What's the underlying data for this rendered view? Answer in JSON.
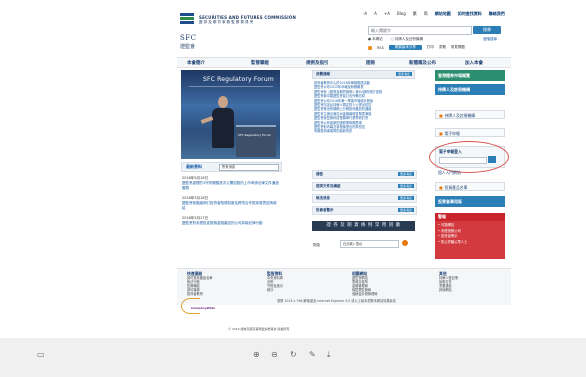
{
  "header": {
    "org_en": "SECURITIES AND FUTURES COMMISSION",
    "org_zh": "證 券 及 期 貨 事 務 監 察 委 員 會",
    "abbr": "SFC",
    "abbr_zh": "證監會",
    "topnav": [
      "-A",
      "A",
      "+A",
      "Blog",
      "繁",
      "简",
      "網站地圖",
      "如何查找資料",
      "聯絡我們"
    ],
    "search_placeholder": "輸入關鍵字",
    "search_button": "搜尋",
    "search_options": [
      "● 本網站",
      "○ 持牌人及註冊機構"
    ],
    "advanced": "進階搜尋",
    "tools": [
      "RSS",
      "網頁版本分享",
      "打印",
      "書籤",
      "常見問題"
    ]
  },
  "mainnav": [
    "本會簡介",
    "監管職能",
    "規例及指引",
    "諮詢",
    "新聞稿及公布",
    "加入本會"
  ],
  "banner": {
    "title": "SFC Regulatory Forum",
    "podium_label": "SFC Regulatory Forum"
  },
  "latest": {
    "title": "最新資料",
    "select": "所有消息"
  },
  "news": [
    {
      "date": "2016年5月18日",
      "text": "證監會處理的3宗有關擬首次公開招股的上市申請法律文件通過審閱"
    },
    {
      "date": "2016年5月18日",
      "text": "證監會就擬議修訂投資者賠償制度及跨境合作框架發表諮詢總結"
    },
    {
      "date": "2016年5月17日",
      "text": "證監會對未經批准推銷金融產品的公司採取紀律行動"
    }
  ],
  "mid": {
    "section1": "消費通報",
    "more": "更多消息",
    "items": [
      "投資者教育中心於2016年舉辦推廣活動",
      "證監會公布2015年年報及財務報表",
      "證監會就《證券及期貨條例》第XV部的修訂諮詢",
      "證監會與中國證監會簽訂合作備忘錄",
      "證監會公布2016年第一季度市場統計數據",
      "證監會向違反持牌人規定的人士提出檢控",
      "證監會發出有關網上分銷投資產品的通函",
      "證監會主席出席亞洲金融論壇並發表演講",
      "證監會就監管科技發展舉行業界研討會",
      "證監會公布最新的證券業財務表現",
      "證監會對內幕交易個案提出刑事檢控",
      "有關投資者保障的最新資訊"
    ],
    "collapsed": [
      "通告",
      "諮詢文件及總結",
      "執法消息",
      "投資者警示"
    ],
    "dark_banner": "證 券 及 期 貨 條 例 常 用 詞 彙",
    "search_label": "詞彙",
    "search_placeholder": "在此輸入搜尋"
  },
  "right": {
    "btn1": "香港證券市場概覽",
    "btn2": "持牌人及註冊機構",
    "link1": "持牌人及註冊機構",
    "link2": "電子申報",
    "login_title": "電子申報登入",
    "login_sub": "個人入門網站",
    "investor1": "投資產品名單",
    "investor2": "投資者專用區",
    "warn_title": "警報",
    "warn_items": [
      "• 可疑網站",
      "• 未經授權公司",
      "• 投資者警示",
      "• 防止詐騙公眾人士"
    ]
  },
  "footer": {
    "col1": [
      "快速連結",
      "認可投資產品名單",
      "執法行動",
      "監管職能",
      "認可機構",
      "投資者教育"
    ],
    "col2": [
      "監管資料",
      "中央資料庫",
      "法例",
      "守則及指引",
      "統計"
    ],
    "col3": [
      "相關網站",
      "證監會網站",
      "香港交易所",
      "金融管理局",
      "保險業監管局",
      "強積金計劃管理局"
    ],
    "col4": [
      "其他",
      "持牌人登記冊",
      "說明文件",
      "重要通告",
      "其他網站"
    ]
  },
  "bottom": {
    "logo_text": "CompanyWide",
    "notes": "瀏覽 1024 x 768 解像度及 Internet Explorer 9.0 或以上版本瀏覽本網站效果最佳",
    "copyright": "© 2016 證券及期貨事務監察委員會 版權所有"
  },
  "toolbar": {
    "icons": [
      "sidebar-toggle-icon",
      "zoom-in-icon",
      "zoom-out-icon",
      "rotate-icon",
      "edit-icon",
      "download-icon"
    ]
  }
}
